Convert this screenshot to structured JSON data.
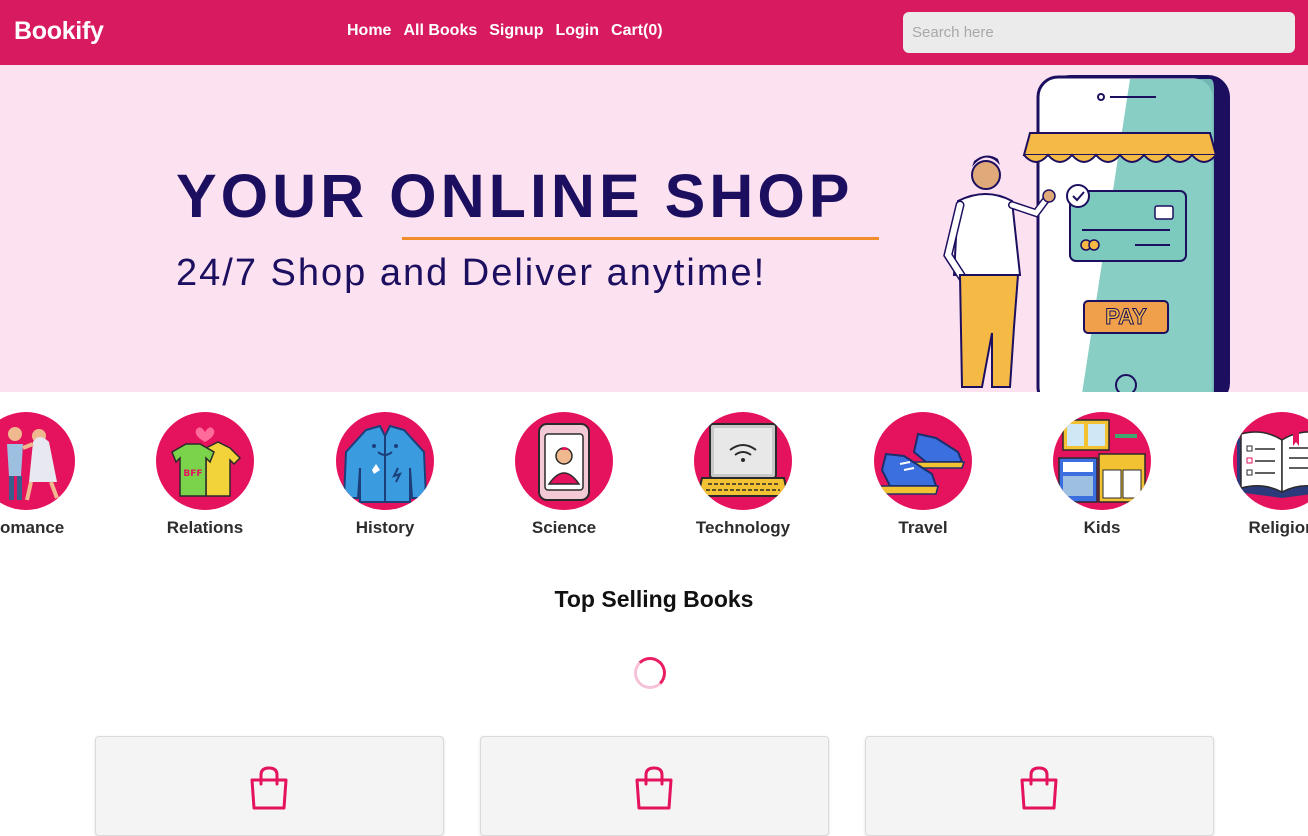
{
  "header": {
    "brand": "Bookify",
    "nav": [
      {
        "label": "Home"
      },
      {
        "label": "All Books"
      },
      {
        "label": "Signup"
      },
      {
        "label": "Login"
      },
      {
        "label": "Cart(0)"
      }
    ],
    "search_placeholder": "Search here"
  },
  "hero": {
    "title": "YOUR ONLINE SHOP",
    "subtitle": "24/7 Shop and Deliver anytime!",
    "pay_label": "PAY"
  },
  "categories": [
    {
      "label": "Romance",
      "icon": "romance-icon"
    },
    {
      "label": "Relations",
      "icon": "tshirts-icon"
    },
    {
      "label": "History",
      "icon": "jacket-icon"
    },
    {
      "label": "Science",
      "icon": "tablet-icon"
    },
    {
      "label": "Technology",
      "icon": "laptop-icon"
    },
    {
      "label": "Travel",
      "icon": "shoes-icon"
    },
    {
      "label": "Kids",
      "icon": "furniture-icon"
    },
    {
      "label": "Religion",
      "icon": "book-icon"
    }
  ],
  "main": {
    "section_title": "Top Selling Books",
    "cards": [
      {
        "icon": "shopping-bag-icon"
      },
      {
        "icon": "shopping-bag-icon"
      },
      {
        "icon": "shopping-bag-icon"
      }
    ]
  },
  "colors": {
    "brand": "#d81b60",
    "hero_bg": "#fce1f1",
    "hero_text": "#1c0f5f",
    "accent_orange": "#ef8d2a",
    "category_circle": "#e5125e"
  }
}
